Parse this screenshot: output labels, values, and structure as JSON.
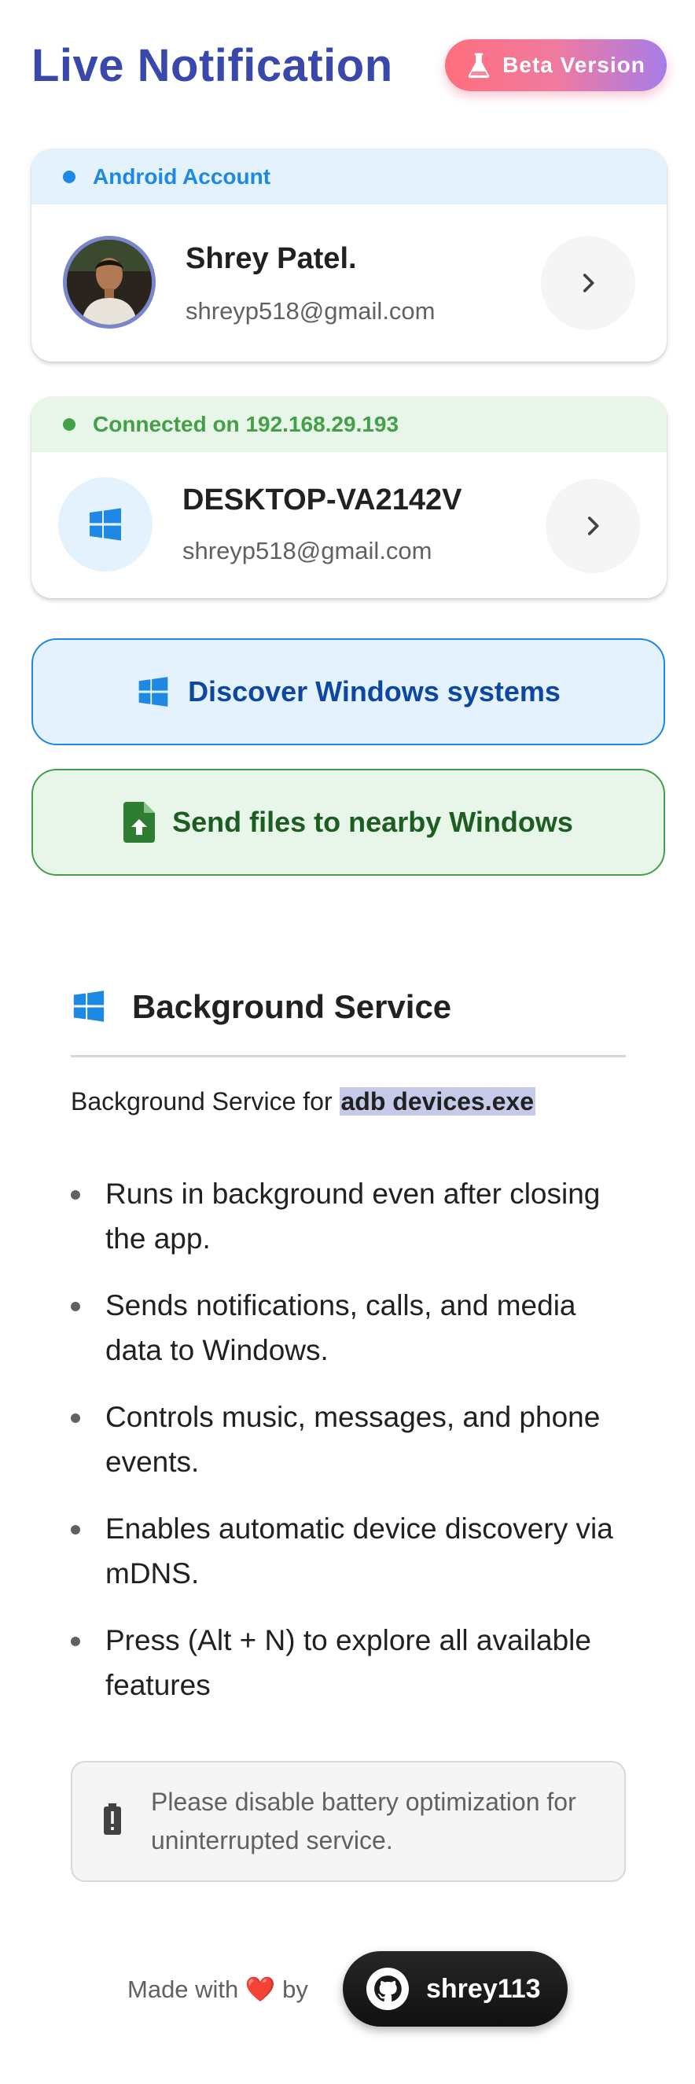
{
  "header": {
    "title": "Live Notification",
    "badge": "Beta Version",
    "badge_icon": "flask-icon"
  },
  "account_card": {
    "status": "Android Account",
    "status_color": "#1e88e5",
    "status_bg": "#e3f2fd",
    "name": "Shrey Patel.",
    "email": "shreyp518@gmail.com"
  },
  "device_card": {
    "status": "Connected on 192.168.29.193",
    "status_color": "#43a047",
    "status_bg": "#e8f5e9",
    "name": "DESKTOP-VA2142V",
    "email": "shreyp518@gmail.com",
    "icon": "windows-icon"
  },
  "buttons": {
    "discover": "Discover Windows systems",
    "send_files": "Send files to nearby Windows"
  },
  "background_service": {
    "title": "Background Service",
    "subtitle_prefix": "Background Service for ",
    "subtitle_highlight": "adb devices.exe",
    "bullets": [
      "Runs in background even after closing the app.",
      "Sends notifications, calls, and media data to Windows.",
      "Controls music, messages, and phone events.",
      "Enables automatic device discovery via mDNS.",
      "Press (Alt + N) to explore all available features"
    ],
    "warning": "Please disable battery optimization for uninterrupted service."
  },
  "footer": {
    "made_with_prefix": "Made with",
    "heart": "❤️",
    "by": "by",
    "github_user": "shrey113"
  }
}
